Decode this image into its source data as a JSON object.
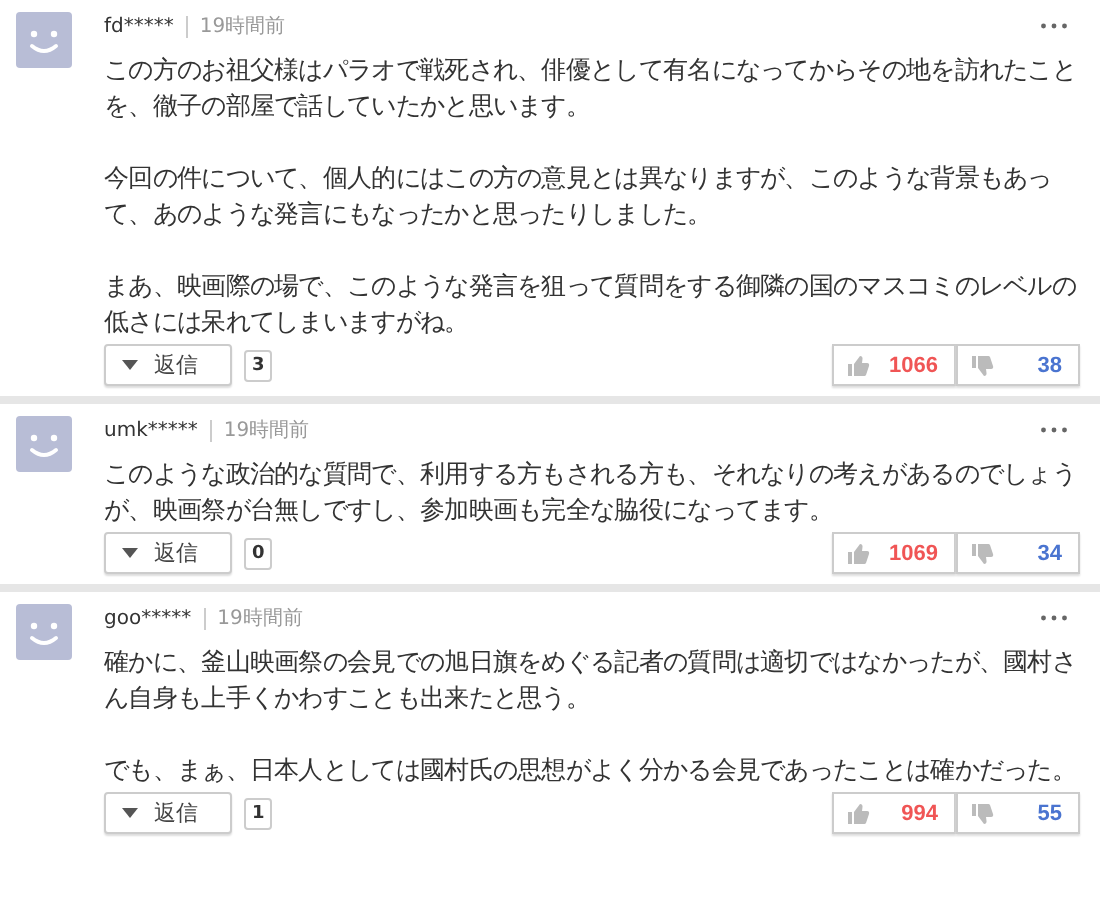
{
  "comments": [
    {
      "user": "fd*****",
      "time": "19時間前",
      "paragraphs": [
        "この方のお祖父様はパラオで戦死され、俳優として有名になってからその地を訪れたことを、徹子の部屋で話していたかと思います。",
        "今回の件について、個人的にはこの方の意見とは異なりますが、このような背景もあって、あのような発言にもなったかと思ったりしました。",
        "まあ、映画際の場で、このような発言を狙って質問をする御隣の国のマスコミのレベルの低さには呆れてしまいますがね。"
      ],
      "reply_label": "返信",
      "reply_count": "3",
      "likes": "1066",
      "dislikes": "38"
    },
    {
      "user": "umk*****",
      "time": "19時間前",
      "paragraphs": [
        "このような政治的な質問で、利用する方もされる方も、それなりの考えがあるのでしょうが、映画祭が台無しですし、参加映画も完全な脇役になってます。"
      ],
      "reply_label": "返信",
      "reply_count": "0",
      "likes": "1069",
      "dislikes": "34"
    },
    {
      "user": "goo*****",
      "time": "19時間前",
      "paragraphs": [
        "確かに、釜山映画祭の会見での旭日旗をめぐる記者の質問は適切ではなかったが、國村さん自身も上手くかわすことも出来たと思う。",
        "でも、まぁ、日本人としては國村氏の思想がよく分かる会見であったことは確かだった。"
      ],
      "reply_label": "返信",
      "reply_count": "1",
      "likes": "994",
      "dislikes": "55"
    }
  ]
}
